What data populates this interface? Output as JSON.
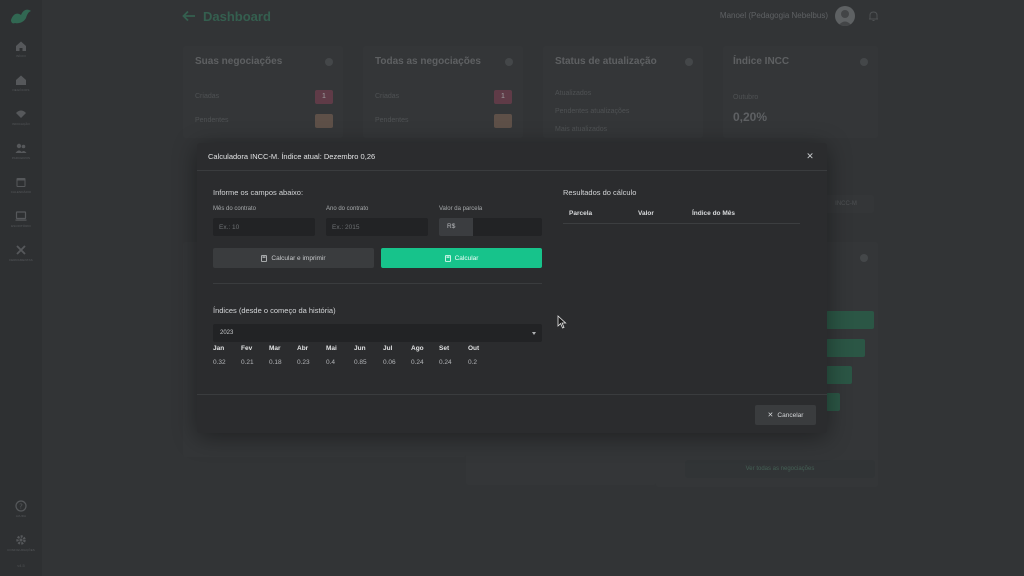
{
  "background": {
    "topbar": {
      "title": "Dashboard",
      "user_name": "Manoel (Pedagogia Nebelbus)"
    },
    "sidebar": {
      "items": [
        {
          "label": "INÍCIO",
          "icon": "home-icon"
        },
        {
          "label": "NEGÓCIOS",
          "icon": "building-icon"
        },
        {
          "label": "INDICAÇÃO",
          "icon": "network-icon"
        },
        {
          "label": "PARCEIROS",
          "icon": "users-icon"
        },
        {
          "label": "CALENDÁRIO",
          "icon": "calendar-icon"
        },
        {
          "label": "ESCRITÓRIO",
          "icon": "monitor-icon"
        },
        {
          "label": "FERRAMENTAS",
          "icon": "tools-icon"
        }
      ],
      "help_label": "AJUDA",
      "settings_label": "CONFIGURAÇÕES",
      "version": "v4.5"
    },
    "cards": {
      "suas": {
        "title": "Suas negociações",
        "row1": "Criadas",
        "row2": "Pendentes",
        "badge1": "1",
        "badge2": ""
      },
      "todas": {
        "title": "Todas as negociações",
        "row1": "Criadas",
        "row2": "Pendentes",
        "badge1": "1",
        "badge2": ""
      },
      "status": {
        "title": "Status de atualização",
        "row1": "Atualizados",
        "row2": "Pendentes atualizações",
        "row3": "Mais atualizados"
      },
      "incc": {
        "title": "Índice INCC",
        "sub": "Outubro",
        "value": "0,20%"
      }
    },
    "bottom_button": "Ver todas as negociações",
    "right_button": "INCC-M"
  },
  "modal": {
    "title": "Calculadora INCC-M. Índice atual: Dezembro 0,26",
    "form_heading": "Informe os campos abaixo:",
    "month_label": "Mês do contrato",
    "month_placeholder": "Ex.: 10",
    "year_label": "Ano do contrato",
    "year_placeholder": "Ex.: 2015",
    "installment_label": "Valor da parcela",
    "currency_prefix": "R$",
    "print_button": "Calcular e imprimir",
    "calc_button": "Calcular",
    "indices_heading": "Índices (desde o começo da história)",
    "selected_year": "2023",
    "months": [
      "Jan",
      "Fev",
      "Mar",
      "Abr",
      "Mai",
      "Jun",
      "Jul",
      "Ago",
      "Set",
      "Out"
    ],
    "values": [
      "0.32",
      "0.21",
      "0.18",
      "0.23",
      "0.4",
      "0.85",
      "0.06",
      "0.24",
      "0.24",
      "0.2"
    ],
    "results_heading": "Resultados do cálculo",
    "results_columns": [
      "Parcela",
      "Valor",
      "Índice do Mês"
    ],
    "cancel_button": "Cancelar"
  },
  "colors": {
    "accent": "#17c38b",
    "badge_red": "#b8546e",
    "badge_tan": "#b38a6a"
  }
}
